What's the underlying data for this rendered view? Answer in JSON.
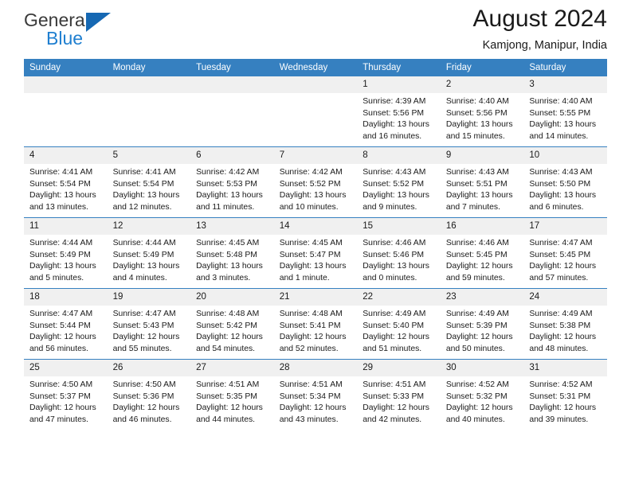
{
  "brand": {
    "name_top": "General",
    "name_bottom": "Blue",
    "accent_color": "#1668b3",
    "text_color": "#3a3a3a"
  },
  "header": {
    "title": "August 2024",
    "location": "Kamjong, Manipur, India"
  },
  "calendar": {
    "header_background": "#3680c0",
    "header_text_color": "#ffffff",
    "daynum_background": "#f0f0f0",
    "weekday_headers": [
      "Sunday",
      "Monday",
      "Tuesday",
      "Wednesday",
      "Thursday",
      "Friday",
      "Saturday"
    ],
    "weeks": [
      [
        {
          "day": "",
          "empty": true
        },
        {
          "day": "",
          "empty": true
        },
        {
          "day": "",
          "empty": true
        },
        {
          "day": "",
          "empty": true
        },
        {
          "day": "1",
          "sunrise": "Sunrise: 4:39 AM",
          "sunset": "Sunset: 5:56 PM",
          "daylight_line1": "Daylight: 13 hours",
          "daylight_line2": "and 16 minutes."
        },
        {
          "day": "2",
          "sunrise": "Sunrise: 4:40 AM",
          "sunset": "Sunset: 5:56 PM",
          "daylight_line1": "Daylight: 13 hours",
          "daylight_line2": "and 15 minutes."
        },
        {
          "day": "3",
          "sunrise": "Sunrise: 4:40 AM",
          "sunset": "Sunset: 5:55 PM",
          "daylight_line1": "Daylight: 13 hours",
          "daylight_line2": "and 14 minutes."
        }
      ],
      [
        {
          "day": "4",
          "sunrise": "Sunrise: 4:41 AM",
          "sunset": "Sunset: 5:54 PM",
          "daylight_line1": "Daylight: 13 hours",
          "daylight_line2": "and 13 minutes."
        },
        {
          "day": "5",
          "sunrise": "Sunrise: 4:41 AM",
          "sunset": "Sunset: 5:54 PM",
          "daylight_line1": "Daylight: 13 hours",
          "daylight_line2": "and 12 minutes."
        },
        {
          "day": "6",
          "sunrise": "Sunrise: 4:42 AM",
          "sunset": "Sunset: 5:53 PM",
          "daylight_line1": "Daylight: 13 hours",
          "daylight_line2": "and 11 minutes."
        },
        {
          "day": "7",
          "sunrise": "Sunrise: 4:42 AM",
          "sunset": "Sunset: 5:52 PM",
          "daylight_line1": "Daylight: 13 hours",
          "daylight_line2": "and 10 minutes."
        },
        {
          "day": "8",
          "sunrise": "Sunrise: 4:43 AM",
          "sunset": "Sunset: 5:52 PM",
          "daylight_line1": "Daylight: 13 hours",
          "daylight_line2": "and 9 minutes."
        },
        {
          "day": "9",
          "sunrise": "Sunrise: 4:43 AM",
          "sunset": "Sunset: 5:51 PM",
          "daylight_line1": "Daylight: 13 hours",
          "daylight_line2": "and 7 minutes."
        },
        {
          "day": "10",
          "sunrise": "Sunrise: 4:43 AM",
          "sunset": "Sunset: 5:50 PM",
          "daylight_line1": "Daylight: 13 hours",
          "daylight_line2": "and 6 minutes."
        }
      ],
      [
        {
          "day": "11",
          "sunrise": "Sunrise: 4:44 AM",
          "sunset": "Sunset: 5:49 PM",
          "daylight_line1": "Daylight: 13 hours",
          "daylight_line2": "and 5 minutes."
        },
        {
          "day": "12",
          "sunrise": "Sunrise: 4:44 AM",
          "sunset": "Sunset: 5:49 PM",
          "daylight_line1": "Daylight: 13 hours",
          "daylight_line2": "and 4 minutes."
        },
        {
          "day": "13",
          "sunrise": "Sunrise: 4:45 AM",
          "sunset": "Sunset: 5:48 PM",
          "daylight_line1": "Daylight: 13 hours",
          "daylight_line2": "and 3 minutes."
        },
        {
          "day": "14",
          "sunrise": "Sunrise: 4:45 AM",
          "sunset": "Sunset: 5:47 PM",
          "daylight_line1": "Daylight: 13 hours",
          "daylight_line2": "and 1 minute."
        },
        {
          "day": "15",
          "sunrise": "Sunrise: 4:46 AM",
          "sunset": "Sunset: 5:46 PM",
          "daylight_line1": "Daylight: 13 hours",
          "daylight_line2": "and 0 minutes."
        },
        {
          "day": "16",
          "sunrise": "Sunrise: 4:46 AM",
          "sunset": "Sunset: 5:45 PM",
          "daylight_line1": "Daylight: 12 hours",
          "daylight_line2": "and 59 minutes."
        },
        {
          "day": "17",
          "sunrise": "Sunrise: 4:47 AM",
          "sunset": "Sunset: 5:45 PM",
          "daylight_line1": "Daylight: 12 hours",
          "daylight_line2": "and 57 minutes."
        }
      ],
      [
        {
          "day": "18",
          "sunrise": "Sunrise: 4:47 AM",
          "sunset": "Sunset: 5:44 PM",
          "daylight_line1": "Daylight: 12 hours",
          "daylight_line2": "and 56 minutes."
        },
        {
          "day": "19",
          "sunrise": "Sunrise: 4:47 AM",
          "sunset": "Sunset: 5:43 PM",
          "daylight_line1": "Daylight: 12 hours",
          "daylight_line2": "and 55 minutes."
        },
        {
          "day": "20",
          "sunrise": "Sunrise: 4:48 AM",
          "sunset": "Sunset: 5:42 PM",
          "daylight_line1": "Daylight: 12 hours",
          "daylight_line2": "and 54 minutes."
        },
        {
          "day": "21",
          "sunrise": "Sunrise: 4:48 AM",
          "sunset": "Sunset: 5:41 PM",
          "daylight_line1": "Daylight: 12 hours",
          "daylight_line2": "and 52 minutes."
        },
        {
          "day": "22",
          "sunrise": "Sunrise: 4:49 AM",
          "sunset": "Sunset: 5:40 PM",
          "daylight_line1": "Daylight: 12 hours",
          "daylight_line2": "and 51 minutes."
        },
        {
          "day": "23",
          "sunrise": "Sunrise: 4:49 AM",
          "sunset": "Sunset: 5:39 PM",
          "daylight_line1": "Daylight: 12 hours",
          "daylight_line2": "and 50 minutes."
        },
        {
          "day": "24",
          "sunrise": "Sunrise: 4:49 AM",
          "sunset": "Sunset: 5:38 PM",
          "daylight_line1": "Daylight: 12 hours",
          "daylight_line2": "and 48 minutes."
        }
      ],
      [
        {
          "day": "25",
          "sunrise": "Sunrise: 4:50 AM",
          "sunset": "Sunset: 5:37 PM",
          "daylight_line1": "Daylight: 12 hours",
          "daylight_line2": "and 47 minutes."
        },
        {
          "day": "26",
          "sunrise": "Sunrise: 4:50 AM",
          "sunset": "Sunset: 5:36 PM",
          "daylight_line1": "Daylight: 12 hours",
          "daylight_line2": "and 46 minutes."
        },
        {
          "day": "27",
          "sunrise": "Sunrise: 4:51 AM",
          "sunset": "Sunset: 5:35 PM",
          "daylight_line1": "Daylight: 12 hours",
          "daylight_line2": "and 44 minutes."
        },
        {
          "day": "28",
          "sunrise": "Sunrise: 4:51 AM",
          "sunset": "Sunset: 5:34 PM",
          "daylight_line1": "Daylight: 12 hours",
          "daylight_line2": "and 43 minutes."
        },
        {
          "day": "29",
          "sunrise": "Sunrise: 4:51 AM",
          "sunset": "Sunset: 5:33 PM",
          "daylight_line1": "Daylight: 12 hours",
          "daylight_line2": "and 42 minutes."
        },
        {
          "day": "30",
          "sunrise": "Sunrise: 4:52 AM",
          "sunset": "Sunset: 5:32 PM",
          "daylight_line1": "Daylight: 12 hours",
          "daylight_line2": "and 40 minutes."
        },
        {
          "day": "31",
          "sunrise": "Sunrise: 4:52 AM",
          "sunset": "Sunset: 5:31 PM",
          "daylight_line1": "Daylight: 12 hours",
          "daylight_line2": "and 39 minutes."
        }
      ]
    ]
  }
}
